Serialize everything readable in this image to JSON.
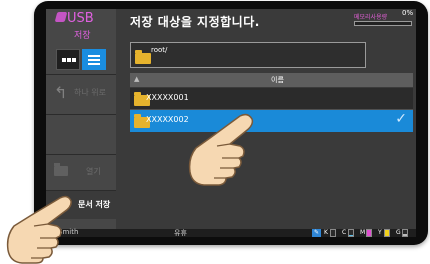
{
  "sidebar": {
    "brand_title": "USB",
    "brand_subtitle": "저장",
    "up_label": "하나 위로",
    "open_label": "열기",
    "save_label": "문서 저장"
  },
  "main": {
    "title": "저장 대상을 지정합니다.",
    "memory_label": "메모리사용량",
    "memory_percent": "0%",
    "memory_fraction": 0.0,
    "path": "root/",
    "column_header": "이름",
    "files": [
      {
        "name": "XXXXX001",
        "selected": false
      },
      {
        "name": "XXXXX002",
        "selected": true
      }
    ]
  },
  "status": {
    "user": "Smith",
    "middle_text": "유휴",
    "toner": [
      {
        "label": "K",
        "level": 0.35,
        "color": "#2a2a2a"
      },
      {
        "label": "C",
        "level": 0.15,
        "color": "#5bc0e8"
      },
      {
        "label": "M",
        "level": 1.0,
        "color": "#e04fd0"
      },
      {
        "label": "Y",
        "level": 1.0,
        "color": "#f1d21d"
      },
      {
        "label": "G",
        "level": 0.4,
        "color": "#bbbbbb"
      }
    ]
  },
  "colors": {
    "accent": "#1a8ad8",
    "brand": "#e060e0",
    "folder": "#e6b32d"
  }
}
